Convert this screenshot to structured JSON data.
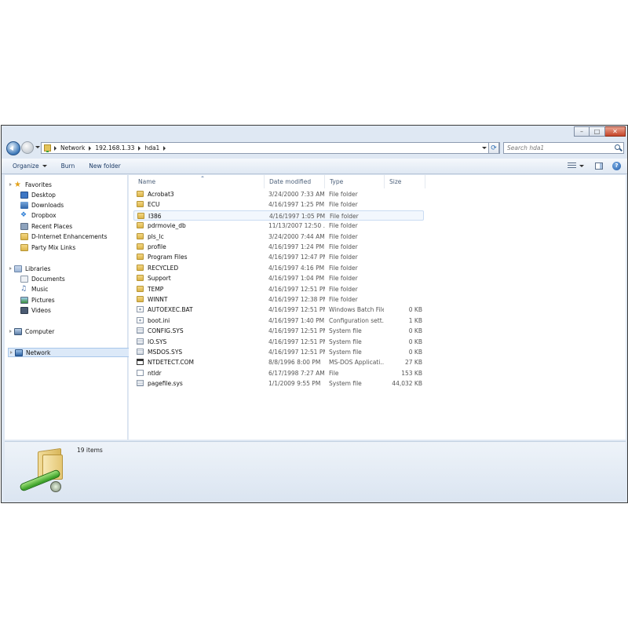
{
  "address": {
    "breadcrumbs": [
      "Network",
      "192.168.1.33",
      "hda1"
    ],
    "search_placeholder": "Search hda1"
  },
  "toolbar": {
    "organize": "Organize",
    "burn": "Burn",
    "new_folder": "New folder"
  },
  "navigation": {
    "favorites_label": "Favorites",
    "favorites": [
      "Desktop",
      "Downloads",
      "Dropbox",
      "Recent Places",
      "D-Internet Enhancements",
      "Party Mix Links"
    ],
    "libraries_label": "Libraries",
    "libraries": [
      "Documents",
      "Music",
      "Pictures",
      "Videos"
    ],
    "computer_label": "Computer",
    "network_label": "Network"
  },
  "columns": {
    "name": "Name",
    "date": "Date modified",
    "type": "Type",
    "size": "Size"
  },
  "files": [
    {
      "name": "Acrobat3",
      "date": "3/24/2000 7:33 AM",
      "type": "File folder",
      "size": "",
      "icon": "folder-icon"
    },
    {
      "name": "ECU",
      "date": "4/16/1997 1:25 PM",
      "type": "File folder",
      "size": "",
      "icon": "folder-icon"
    },
    {
      "name": "I386",
      "date": "4/16/1997 1:05 PM",
      "type": "File folder",
      "size": "",
      "icon": "folder-icon"
    },
    {
      "name": "pdrmovie_db",
      "date": "11/13/2007 12:50 ...",
      "type": "File folder",
      "size": "",
      "icon": "folder-icon"
    },
    {
      "name": "pls_lc",
      "date": "3/24/2000 7:44 AM",
      "type": "File folder",
      "size": "",
      "icon": "folder-icon"
    },
    {
      "name": "profile",
      "date": "4/16/1997 1:24 PM",
      "type": "File folder",
      "size": "",
      "icon": "folder-icon"
    },
    {
      "name": "Program Files",
      "date": "4/16/1997 12:47 PM",
      "type": "File folder",
      "size": "",
      "icon": "folder-icon"
    },
    {
      "name": "RECYCLED",
      "date": "4/16/1997 4:16 PM",
      "type": "File folder",
      "size": "",
      "icon": "folder-icon"
    },
    {
      "name": "Support",
      "date": "4/16/1997 1:04 PM",
      "type": "File folder",
      "size": "",
      "icon": "folder-icon"
    },
    {
      "name": "TEMP",
      "date": "4/16/1997 12:51 PM",
      "type": "File folder",
      "size": "",
      "icon": "folder-icon"
    },
    {
      "name": "WINNT",
      "date": "4/16/1997 12:38 PM",
      "type": "File folder",
      "size": "",
      "icon": "folder-icon"
    },
    {
      "name": "AUTOEXEC.BAT",
      "date": "4/16/1997 12:51 PM",
      "type": "Windows Batch File",
      "size": "0 KB",
      "icon": "gear-file-icon"
    },
    {
      "name": "boot.ini",
      "date": "4/16/1997 1:40 PM",
      "type": "Configuration sett...",
      "size": "1 KB",
      "icon": "config-file-icon"
    },
    {
      "name": "CONFIG.SYS",
      "date": "4/16/1997 12:51 PM",
      "type": "System file",
      "size": "0 KB",
      "icon": "system-file-icon"
    },
    {
      "name": "IO.SYS",
      "date": "4/16/1997 12:51 PM",
      "type": "System file",
      "size": "0 KB",
      "icon": "system-file-icon"
    },
    {
      "name": "MSDOS.SYS",
      "date": "4/16/1997 12:51 PM",
      "type": "System file",
      "size": "0 KB",
      "icon": "system-file-icon"
    },
    {
      "name": "NTDETECT.COM",
      "date": "8/8/1996 8:00 PM",
      "type": "MS-DOS Applicati...",
      "size": "27 KB",
      "icon": "application-icon"
    },
    {
      "name": "ntldr",
      "date": "6/17/1998 7:27 AM",
      "type": "File",
      "size": "153 KB",
      "icon": "file-icon"
    },
    {
      "name": "pagefile.sys",
      "date": "1/1/2009 9:55 PM",
      "type": "System file",
      "size": "44,032 KB",
      "icon": "system-file-icon"
    }
  ],
  "status": {
    "item_count": "19 items"
  }
}
